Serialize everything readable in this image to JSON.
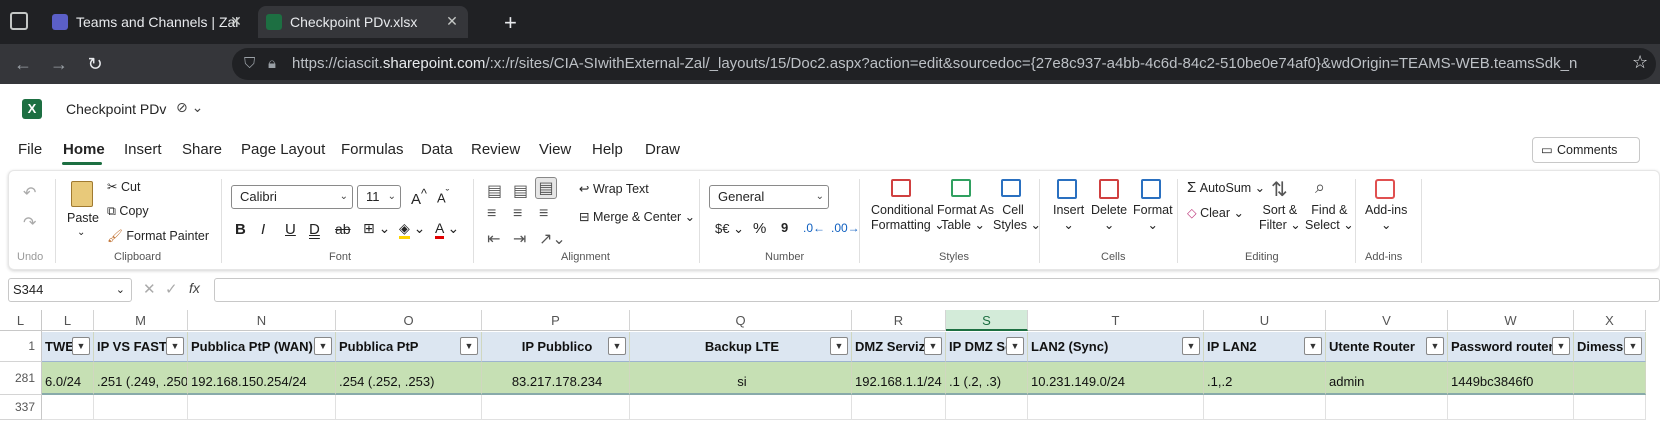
{
  "browser": {
    "tabs": [
      {
        "label": "Teams and Channels | Zal"
      },
      {
        "label": "Checkpoint PDv.xlsx"
      }
    ],
    "url_pre": "https://ciascit.",
    "url_host": "sharepoint.com",
    "url_rest": "/:x:/r/sites/CIA-SIwithExternal-Zal/_layouts/15/Doc2.aspx?action=edit&sourcedoc={27e8c937-a4bb-4c6d-84c2-510be0e74af0}&wdOrigin=TEAMS-WEB.teamsSdk_n"
  },
  "app": {
    "title": "Checkpoint PDv",
    "comments_label": "Comments"
  },
  "menu": [
    "File",
    "Home",
    "Insert",
    "Share",
    "Page Layout",
    "Formulas",
    "Data",
    "Review",
    "View",
    "Help",
    "Draw"
  ],
  "ribbon": {
    "undo_label": "Undo",
    "paste": "Paste",
    "cut": "Cut",
    "copy": "Copy",
    "format_painter": "Format Painter",
    "clipboard": "Clipboard",
    "font_name": "Calibri",
    "font_size": "11",
    "font": "Font",
    "wrap_text": "Wrap Text",
    "merge_center": "Merge & Center",
    "alignment": "Alignment",
    "number_format": "General",
    "currency_symbol": "$€",
    "percent": "%",
    "comma": "9",
    "number": "Number",
    "cond_fmt_1": "Conditional",
    "cond_fmt_2": "Formatting",
    "format_table_1": "Format As",
    "format_table_2": "Table",
    "cell_styles_1": "Cell",
    "cell_styles_2": "Styles",
    "styles": "Styles",
    "insert": "Insert",
    "delete": "Delete",
    "format": "Format",
    "cells": "Cells",
    "autosum": "AutoSum",
    "clear": "Clear",
    "sort_1": "Sort &",
    "sort_2": "Filter",
    "find_1": "Find &",
    "find_2": "Select",
    "editing": "Editing",
    "addins": "Add-ins",
    "addins_group": "Add-ins"
  },
  "namebox": "S344",
  "fx": "fx",
  "columns": [
    {
      "letter": "L",
      "header": "TWEB"
    },
    {
      "letter": "M",
      "header": "IP VS FASTW"
    },
    {
      "letter": "N",
      "header": "Pubblica PtP (WAN)"
    },
    {
      "letter": "O",
      "header": "Pubblica PtP"
    },
    {
      "letter": "P",
      "header": "IP Pubblico"
    },
    {
      "letter": "Q",
      "header": "Backup LTE"
    },
    {
      "letter": "R",
      "header": "DMZ Servizi"
    },
    {
      "letter": "S",
      "header": "IP DMZ Se"
    },
    {
      "letter": "T",
      "header": "LAN2 (Sync)"
    },
    {
      "letter": "U",
      "header": "IP LAN2"
    },
    {
      "letter": "V",
      "header": "Utente Router"
    },
    {
      "letter": "W",
      "header": "Password router"
    },
    {
      "letter": "X",
      "header": "Dimess"
    }
  ],
  "rows": [
    {
      "num": "1"
    },
    {
      "num": "281",
      "cells": [
        "6.0/24",
        ".251 (.249, .250",
        "192.168.150.254/24",
        ".254 (.252, .253)",
        "83.217.178.234",
        "si",
        "192.168.1.1/24",
        ".1 (.2, .3)",
        "10.231.149.0/24",
        ".1,.2",
        "admin",
        "1449bc3846f0",
        ""
      ]
    },
    {
      "num": "337"
    }
  ]
}
